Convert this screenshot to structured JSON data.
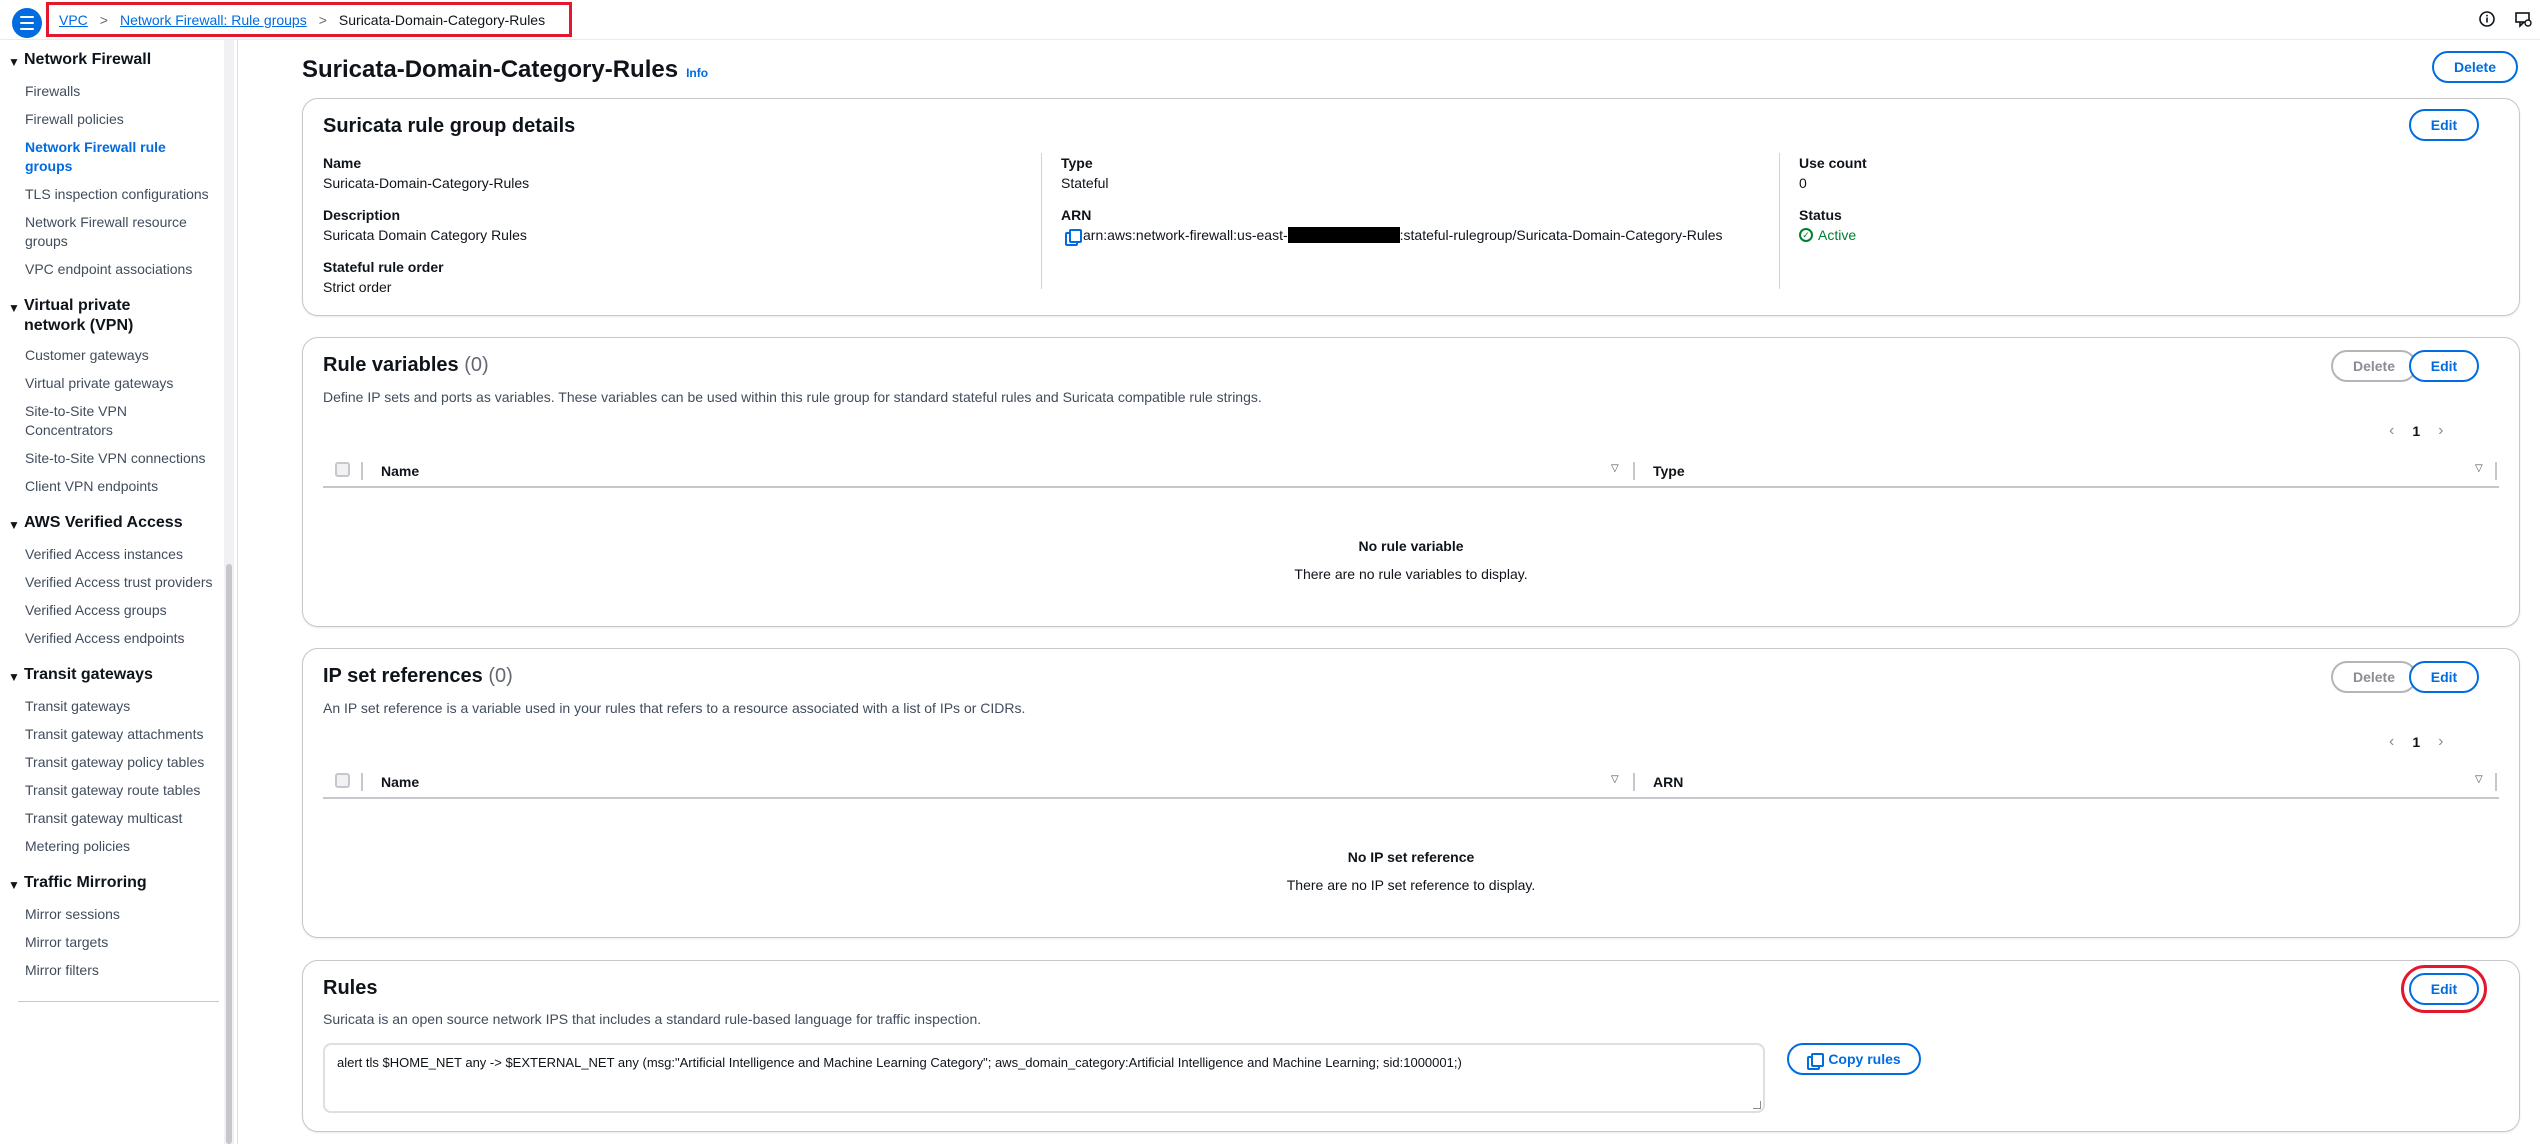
{
  "breadcrumb": {
    "items": [
      "VPC",
      "Network Firewall: Rule groups"
    ],
    "current": "Suricata-Domain-Category-Rules",
    "separator": ">"
  },
  "topbar": {
    "info_icon": "info-circle-icon",
    "feedback_icon": "feedback-icon"
  },
  "sidebar": {
    "sections": [
      {
        "title": "Network Firewall",
        "items": [
          "Firewalls",
          "Firewall policies",
          "Network Firewall rule groups",
          "TLS inspection configurations",
          "Network Firewall resource groups",
          "VPC endpoint associations"
        ]
      },
      {
        "title": "Virtual private network (VPN)",
        "items": [
          "Customer gateways",
          "Virtual private gateways",
          "Site-to-Site VPN Concentrators",
          "Site-to-Site VPN connections",
          "Client VPN endpoints"
        ]
      },
      {
        "title": "AWS Verified Access",
        "items": [
          "Verified Access instances",
          "Verified Access trust providers",
          "Verified Access groups",
          "Verified Access endpoints"
        ]
      },
      {
        "title": "Transit gateways",
        "items": [
          "Transit gateways",
          "Transit gateway attachments",
          "Transit gateway policy tables",
          "Transit gateway route tables",
          "Transit gateway multicast",
          "Metering policies"
        ]
      },
      {
        "title": "Traffic Mirroring",
        "items": [
          "Mirror sessions",
          "Mirror targets",
          "Mirror filters"
        ]
      }
    ],
    "active_item": "Network Firewall rule groups"
  },
  "page": {
    "title": "Suricata-Domain-Category-Rules",
    "info": "Info",
    "delete_label": "Delete"
  },
  "details": {
    "title": "Suricata rule group details",
    "edit_label": "Edit",
    "name_label": "Name",
    "name_value": "Suricata-Domain-Category-Rules",
    "description_label": "Description",
    "description_value": "Suricata Domain Category Rules",
    "order_label": "Stateful rule order",
    "order_value": "Strict order",
    "type_label": "Type",
    "type_value": "Stateful",
    "arn_label": "ARN",
    "arn_prefix": "arn:aws:network-firewall:us-east-",
    "arn_suffix": ":stateful-rulegroup/Suricata-Domain-Category-Rules",
    "use_count_label": "Use count",
    "use_count_value": "0",
    "status_label": "Status",
    "status_value": "Active",
    "status_color": "#00802f"
  },
  "rule_variables": {
    "title": "Rule variables",
    "count": "(0)",
    "description": "Define IP sets and ports as variables. These variables can be used within this rule group for standard stateful rules and Suricata compatible rule strings.",
    "delete_label": "Delete",
    "edit_label": "Edit",
    "page": "1",
    "columns": [
      "Name",
      "Type"
    ],
    "empty_title": "No rule variable",
    "empty_desc": "There are no rule variables to display."
  },
  "ip_set_references": {
    "title": "IP set references",
    "count": "(0)",
    "description": "An IP set reference is a variable used in your rules that refers to a resource associated with a list of IPs or CIDRs.",
    "delete_label": "Delete",
    "edit_label": "Edit",
    "page": "1",
    "columns": [
      "Name",
      "ARN"
    ],
    "empty_title": "No IP set reference",
    "empty_desc": "There are no IP set reference to display."
  },
  "rules": {
    "title": "Rules",
    "description": "Suricata is an open source network IPS that includes a standard rule-based language for traffic inspection.",
    "edit_label": "Edit",
    "rule_text": "alert tls $HOME_NET any -> $EXTERNAL_NET any (msg:\"Artificial Intelligence and Machine Learning Category\"; aws_domain_category:Artificial Intelligence and Machine Learning; sid:1000001;)",
    "copy_label": "Copy rules"
  },
  "colors": {
    "accent": "#006ce0",
    "highlight": "#e3172d"
  }
}
